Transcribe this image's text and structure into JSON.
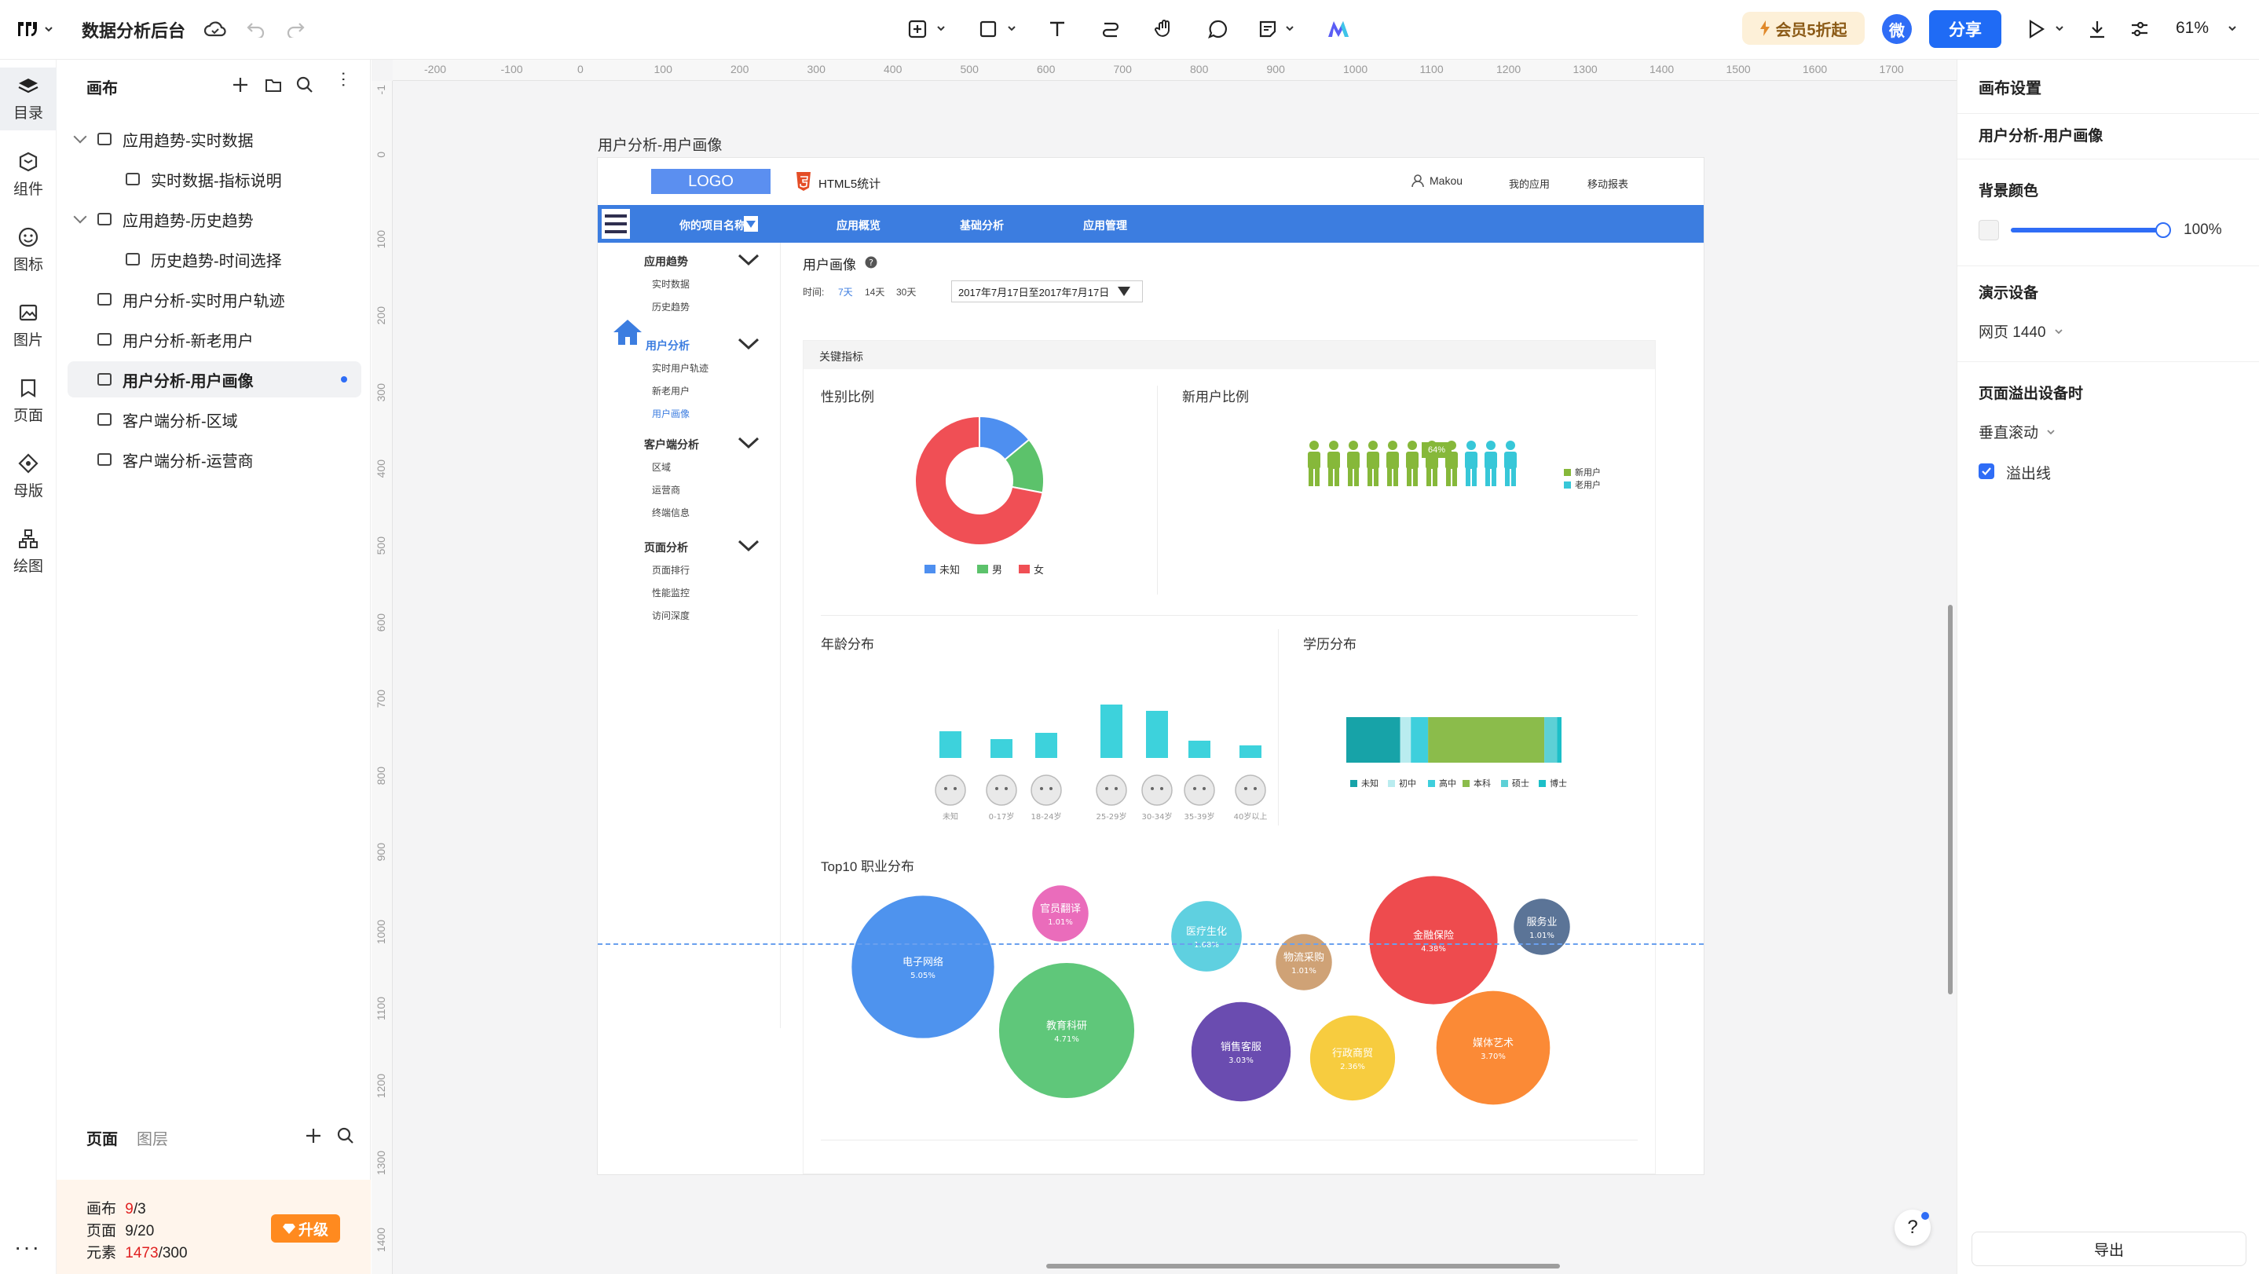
{
  "app": {
    "title": "数据分析后台",
    "zoom": "61%"
  },
  "topbar": {
    "vip_label": "会员5折起",
    "avatar_text": "微",
    "share_label": "分享"
  },
  "rail": [
    "目录",
    "组件",
    "图标",
    "图片",
    "页面",
    "母版",
    "绘图"
  ],
  "left_panel": {
    "title": "画布",
    "items": [
      {
        "label": "应用趋势-实时数据",
        "level": 0,
        "expanded": true
      },
      {
        "label": "实时数据-指标说明",
        "level": 1
      },
      {
        "label": "应用趋势-历史趋势",
        "level": 0,
        "expanded": true
      },
      {
        "label": "历史趋势-时间选择",
        "level": 1
      },
      {
        "label": "用户分析-实时用户轨迹",
        "level": 0
      },
      {
        "label": "用户分析-新老用户",
        "level": 0
      },
      {
        "label": "用户分析-用户画像",
        "level": 0,
        "selected": true
      },
      {
        "label": "客户端分析-区域",
        "level": 0
      },
      {
        "label": "客户端分析-运营商",
        "level": 0
      }
    ],
    "bottom_tabs": [
      "页面",
      "图层"
    ]
  },
  "quota": {
    "canvas_label": "画布",
    "canvas_used": "9",
    "canvas_total": "/3",
    "page_label": "页面",
    "page_val": "9/20",
    "element_label": "元素",
    "element_used": "1473",
    "element_total": "/300",
    "upgrade_label": "升级"
  },
  "ruler": {
    "h": [
      "-200",
      "-100",
      "0",
      "100",
      "200",
      "300",
      "400",
      "500",
      "600",
      "700",
      "800",
      "900",
      "1000",
      "1100",
      "1200",
      "1300",
      "1400",
      "1500",
      "1600",
      "1700"
    ],
    "v": [
      "-1",
      "0",
      "100",
      "200",
      "300",
      "400",
      "500",
      "600",
      "700",
      "800",
      "900",
      "1000",
      "1100",
      "1200",
      "1300",
      "1400"
    ]
  },
  "artboard_label": "用户分析-用户画像",
  "frame": {
    "logo": "LOGO",
    "html5": "HTML5统计",
    "user": "Makou",
    "header_links": [
      "我的应用",
      "移动报表"
    ],
    "nav": [
      "你的项目名称",
      "应用概览",
      "基础分析",
      "应用管理"
    ],
    "sidebar": [
      {
        "head": "应用趋势",
        "items": [
          "实时数据",
          "历史趋势"
        ]
      },
      {
        "head": "用户分析",
        "items": [
          "实时用户轨迹",
          "新老用户",
          "用户画像"
        ]
      },
      {
        "head": "客户端分析",
        "items": [
          "区域",
          "运营商",
          "终端信息"
        ]
      },
      {
        "head": "页面分析",
        "items": [
          "页面排行",
          "性能监控",
          "访问深度"
        ]
      }
    ],
    "page_title": "用户画像",
    "time_label": "时间:",
    "time_options": [
      "7天",
      "14天",
      "30天"
    ],
    "date_range": "2017年7月17日至2017年7月17日",
    "section_title": "关键指标",
    "charts": {
      "gender": {
        "title": "性别比例",
        "legend": [
          "未知",
          "男",
          "女"
        ]
      },
      "new_user": {
        "title": "新用户比例",
        "badge": "64%",
        "legend": [
          "新用户",
          "老用户"
        ]
      },
      "age": {
        "title": "年龄分布",
        "labels": [
          "未知",
          "0-17岁",
          "18-24岁",
          "25-29岁",
          "30-34岁",
          "35-39岁",
          "40岁以上"
        ]
      },
      "edu": {
        "title": "学历分布",
        "legend": [
          "未知",
          "初中",
          "高中",
          "本科",
          "硕士",
          "博士"
        ]
      },
      "job": {
        "title": "Top10 职业分布"
      }
    }
  },
  "chart_data": [
    {
      "type": "pie",
      "categories": [
        "未知",
        "男",
        "女"
      ],
      "values": [
        14,
        14,
        72
      ],
      "title": "性别比例",
      "colors": [
        "#4e8ff0",
        "#5cc26b",
        "#f04f55"
      ]
    },
    {
      "type": "bar",
      "categories": [
        "新用户",
        "老用户"
      ],
      "values": [
        64,
        36
      ],
      "title": "新用户比例",
      "colors": [
        "#86b83a",
        "#37c7d8"
      ]
    },
    {
      "type": "bar",
      "categories": [
        "未知",
        "0-17岁",
        "18-24岁",
        "25-29岁",
        "30-34岁",
        "35-39岁",
        "40岁以上"
      ],
      "values": [
        34,
        24,
        32,
        68,
        60,
        22,
        16
      ],
      "title": "年龄分布",
      "colors": [
        "#3dd2dc"
      ]
    },
    {
      "type": "bar",
      "categories": [
        "未知",
        "初中",
        "高中",
        "本科",
        "硕士",
        "博士"
      ],
      "values": [
        25,
        5,
        8,
        54,
        6,
        2
      ],
      "title": "学历分布",
      "colors": [
        "#17a3a8",
        "#b9ecef",
        "#3ecfdc",
        "#8bbc4b",
        "#5dd0d6",
        "#1cbfc8"
      ]
    },
    {
      "type": "scatter",
      "title": "Top10 职业分布",
      "categories": [
        "电子网络",
        "官员翻译",
        "教育科研",
        "医疗生化",
        "物流采购",
        "销售客服",
        "行政商贸",
        "金融保险",
        "媒体艺术",
        "服务业"
      ],
      "values": [
        5.05,
        1.01,
        4.71,
        1.68,
        1.01,
        3.03,
        2.36,
        4.38,
        3.7,
        1.01
      ],
      "labels": [
        "5.05%",
        "1.01%",
        "4.71%",
        "1.68%",
        "1.01%",
        "3.03%",
        "2.36%",
        "4.38%",
        "3.70%",
        "1.01%"
      ],
      "colors": [
        "#4e93ee",
        "#ea6cbb",
        "#5fc77a",
        "#5fd0e0",
        "#cfa276",
        "#6a4cb0",
        "#f7cc3f",
        "#ee4b4e",
        "#fb8a36",
        "#5b7497"
      ]
    }
  ],
  "right_panel": {
    "canvas_settings": "画布设置",
    "page_name": "用户分析-用户画像",
    "bg_label": "背景颜色",
    "bg_opacity": "100%",
    "device_label": "演示设备",
    "device_value": "网页 1440",
    "overflow_label": "页面溢出设备时",
    "overflow_value": "垂直滚动",
    "overflow_line": "溢出线",
    "export_label": "导出"
  },
  "colors": {
    "accent": "#1f6bf5",
    "nav": "#3c7de0",
    "orange": "#ff8a1f"
  }
}
